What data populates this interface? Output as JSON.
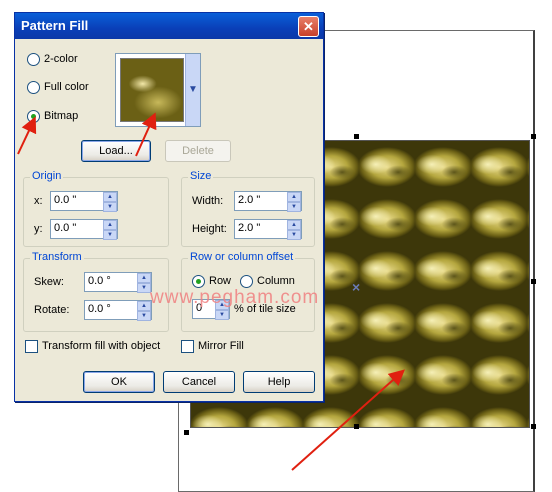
{
  "canvas": {
    "watermark": "www.pegham.com",
    "center_mark": "×"
  },
  "dialog": {
    "title": "Pattern Fill",
    "close_glyph": "✕",
    "fill_types": [
      {
        "label": "2-color",
        "selected": false
      },
      {
        "label": "Full color",
        "selected": false
      },
      {
        "label": "Bitmap",
        "selected": true
      }
    ],
    "load_button": "Load...",
    "delete_button": "Delete",
    "origin": {
      "title": "Origin",
      "x_label": "x:",
      "x_value": "0.0 \"",
      "y_label": "y:",
      "y_value": "0.0 \""
    },
    "size": {
      "title": "Size",
      "width_label": "Width:",
      "width_value": "2.0 \"",
      "height_label": "Height:",
      "height_value": "2.0 \""
    },
    "transform": {
      "title": "Transform",
      "skew_label": "Skew:",
      "skew_value": "0.0 °",
      "rotate_label": "Rotate:",
      "rotate_value": "0.0 °"
    },
    "offset": {
      "title": "Row or column offset",
      "row_label": "Row",
      "column_label": "Column",
      "row_selected": true,
      "percent_value": "0",
      "percent_label": "% of tile size"
    },
    "transform_fill_label": "Transform fill with object",
    "mirror_fill_label": "Mirror Fill",
    "ok_button": "OK",
    "cancel_button": "Cancel",
    "help_button": "Help"
  },
  "colors": {
    "accent": "#0046d5",
    "titlebar": "#0a3fb8",
    "dialog_bg": "#ece9d8",
    "annotation_arrow": "#e02010"
  }
}
